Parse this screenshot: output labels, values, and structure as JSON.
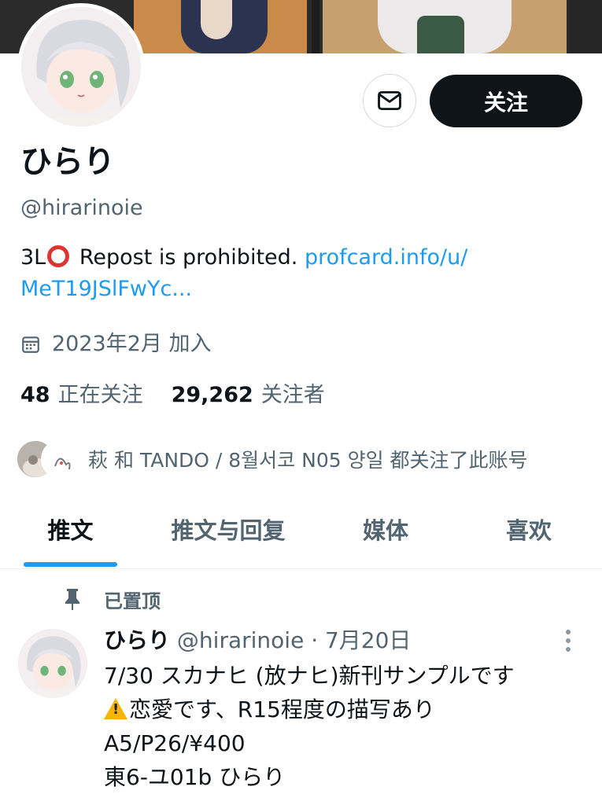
{
  "profile": {
    "display_name": "ひらり",
    "handle": "@hirarinoie",
    "bio_text": "3L",
    "bio_text_2": " Repost is prohibited. ",
    "bio_link_line1": "profcard.info/u/",
    "bio_link_line2": "MeT19JSlFwYc...",
    "joined": "2023年2月 加入",
    "following_count": "48",
    "following_label": "正在关注",
    "followers_count": "29,262",
    "followers_label": "关注者",
    "followed_by": "萩 和 TANDO / 8월서코 N05 양일 都关注了此账号"
  },
  "actions": {
    "follow_label": "关注"
  },
  "tabs": [
    {
      "label": "推文"
    },
    {
      "label": "推文与回复"
    },
    {
      "label": "媒体"
    },
    {
      "label": "喜欢"
    }
  ],
  "pinned_tweet": {
    "pinned_label": "已置顶",
    "author_name": "ひらり",
    "meta": "@hirarinoie · 7月20日",
    "line1": "7/30 スカナヒ (放ナヒ)新刊サンプルです",
    "line2": "恋愛です、R15程度の描写あり",
    "line3": "A5/P26/¥400",
    "line4": "東6-ユ01b ひらり"
  },
  "icons": [
    "mail-icon",
    "calendar-icon",
    "pin-icon",
    "more-icon",
    "warning-icon",
    "red-circle-icon"
  ],
  "colors": {
    "accent": "#1d9bf0",
    "text_primary": "#0f1419",
    "text_secondary": "#536471"
  }
}
